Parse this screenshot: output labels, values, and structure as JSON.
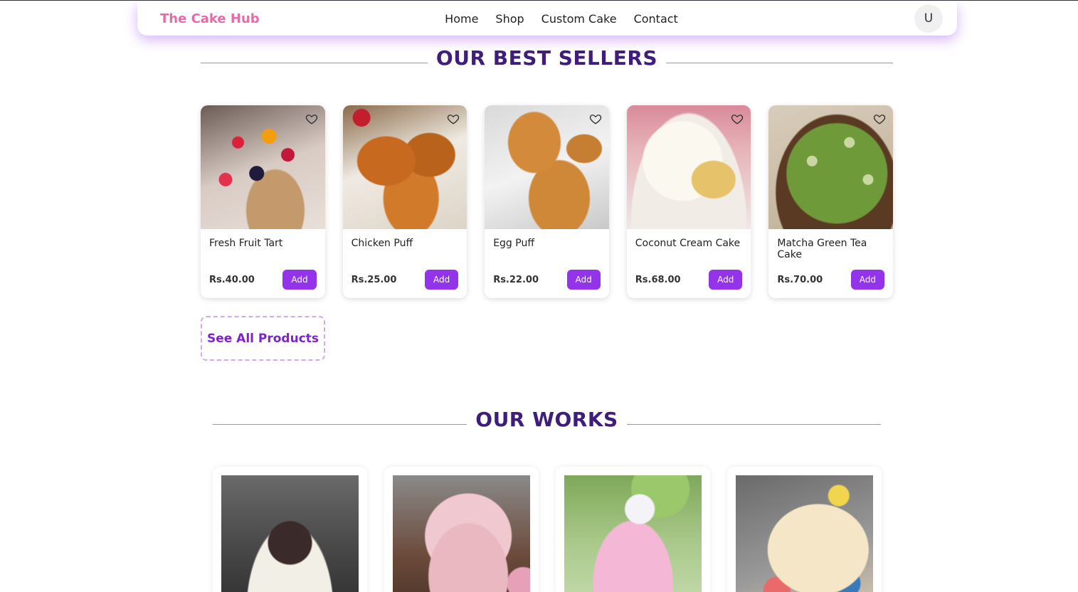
{
  "navbar": {
    "brand": "The Cake Hub",
    "links": [
      "Home",
      "Shop",
      "Custom Cake",
      "Contact"
    ],
    "avatar_initial": "U"
  },
  "best_sellers": {
    "title": "OUR BEST SELLERS",
    "products": [
      {
        "name": "Fresh Fruit Tart",
        "price": "Rs.40.00",
        "add_label": "Add",
        "image": "fruit-tart"
      },
      {
        "name": "Chicken Puff",
        "price": "Rs.25.00",
        "add_label": "Add",
        "image": "chicken-puff"
      },
      {
        "name": "Egg Puff",
        "price": "Rs.22.00",
        "add_label": "Add",
        "image": "egg-puff"
      },
      {
        "name": "Coconut Cream Cake",
        "price": "Rs.68.00",
        "add_label": "Add",
        "image": "coconut-cake"
      },
      {
        "name": "Matcha Green Tea Cake",
        "price": "Rs.70.00",
        "add_label": "Add",
        "image": "matcha-cake"
      }
    ],
    "see_all_label": "See All Products"
  },
  "works": {
    "title": "OUR WORKS",
    "items": [
      "anniversary-cake",
      "graduation-cake",
      "unicorn-cake",
      "butterfly-cake"
    ]
  },
  "colors": {
    "brand": "#e86aa8",
    "heading": "#3f1d7a",
    "accent": "#9333ea",
    "nav_glow": "#a855f7"
  }
}
